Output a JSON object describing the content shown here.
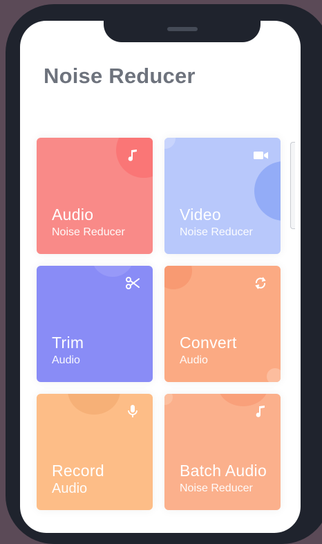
{
  "app": {
    "title": "Noise Reducer"
  },
  "cards": [
    {
      "title": "Audio",
      "subtitle": "Noise Reducer",
      "icon": "music-note-icon",
      "color": "#f98a88"
    },
    {
      "title": "Video",
      "subtitle": "Noise Reducer",
      "icon": "video-camera-icon",
      "color": "#b8c8fb"
    },
    {
      "title": "Trim",
      "subtitle": "Audio",
      "icon": "scissors-icon",
      "color": "#898cf6"
    },
    {
      "title": "Convert",
      "subtitle": "Audio",
      "icon": "convert-arrows-icon",
      "color": "#fbaa83"
    },
    {
      "title": "Record",
      "subtitle": "Audio",
      "icon": "microphone-icon",
      "color": "#fdbd87"
    },
    {
      "title": "Batch Audio",
      "subtitle": "Noise Reducer",
      "icon": "music-note-icon",
      "color": "#fbb08c"
    }
  ]
}
